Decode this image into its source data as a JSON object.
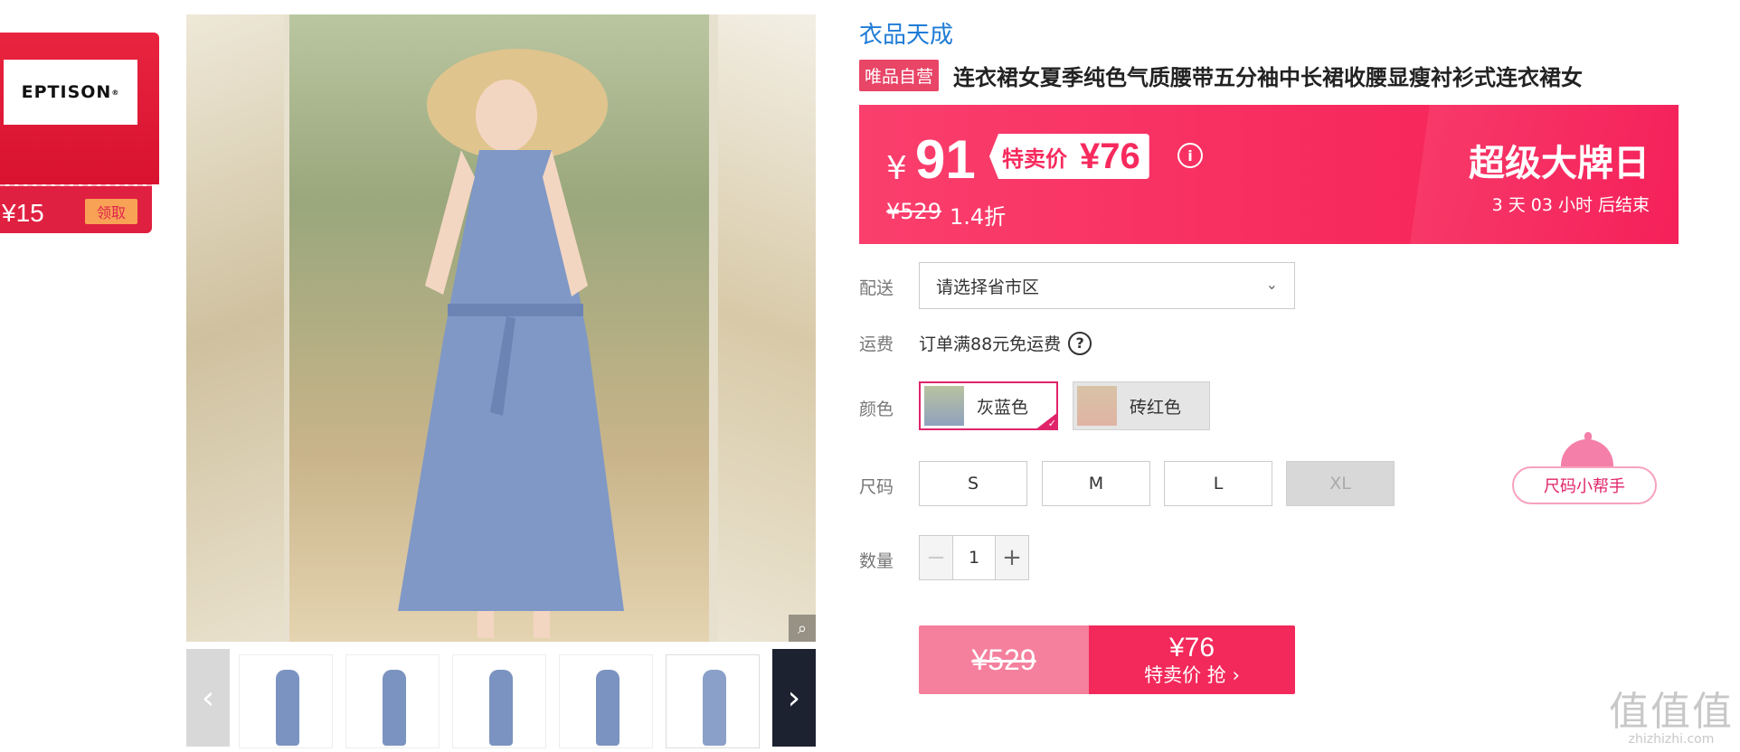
{
  "coupon": {
    "logo_text": "EPTISON",
    "logo_mark": "®",
    "amount": "¥15",
    "claim_label": "领取"
  },
  "gallery": {
    "zoom_icon": "magnifier-icon",
    "thumb_count": 5
  },
  "product": {
    "brand": "衣品天成",
    "self_tag": "唯品自营",
    "title": "连衣裙女夏季纯色气质腰带五分袖中长裙收腰显瘦衬衫式连衣裙女"
  },
  "price": {
    "currency": "¥",
    "main": "91",
    "sale_label": "特卖价",
    "sale_value": "¥76",
    "original": "¥529",
    "discount": "1.4折",
    "event_title": "超级大牌日",
    "countdown": "3  天 03 小时 后结束"
  },
  "delivery": {
    "label": "配送",
    "placeholder": "请选择省市区"
  },
  "shipping": {
    "label": "运费",
    "text": "订单满88元免运费"
  },
  "colors": {
    "label": "颜色",
    "options": [
      {
        "name": "灰蓝色",
        "selected": true
      },
      {
        "name": "砖红色",
        "selected": false
      }
    ]
  },
  "sizes": {
    "label": "尺码",
    "options": [
      {
        "name": "S",
        "available": true
      },
      {
        "name": "M",
        "available": true
      },
      {
        "name": "L",
        "available": true
      },
      {
        "name": "XL",
        "available": false
      }
    ],
    "helper_label": "尺码小帮手"
  },
  "quantity": {
    "label": "数量",
    "value": "1",
    "minus": "−",
    "plus": "+"
  },
  "buy": {
    "original": "¥529",
    "price": "¥76",
    "label": "特卖价 抢 ›"
  },
  "watermark": {
    "big": "值值值",
    "small": "zhizhizhi.com"
  },
  "colors_theme": {
    "accent": "#f72a5d",
    "brand_link": "#1f7cd6"
  }
}
